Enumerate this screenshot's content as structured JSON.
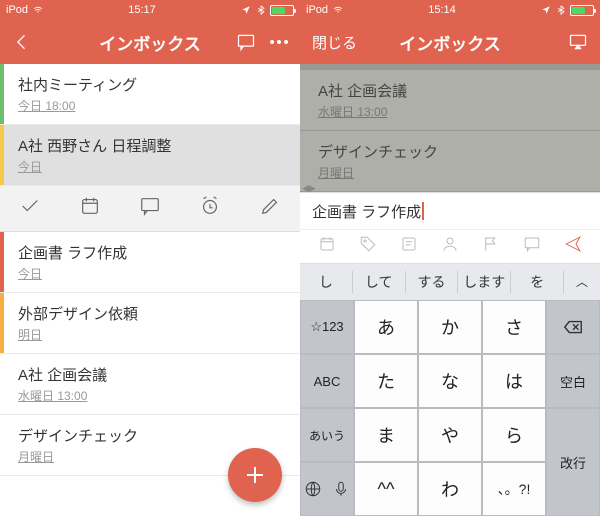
{
  "left": {
    "status": {
      "device": "iPod",
      "time": "15:17"
    },
    "nav": {
      "title": "インボックス"
    },
    "items": [
      {
        "title": "社内ミーティング",
        "sub": "今日 18:00",
        "accent": "green"
      },
      {
        "title": "A社 西野さん 日程調整",
        "sub": "今日",
        "accent": "yellow",
        "selected": true
      },
      {
        "title": "企画書 ラフ作成",
        "sub": "今日",
        "accent": "red"
      },
      {
        "title": "外部デザイン依頼",
        "sub": "明日",
        "accent": "orange"
      },
      {
        "title": "A社 企画会議",
        "sub": "水曜日 13:00",
        "accent": ""
      },
      {
        "title": "デザインチェック",
        "sub": "月曜日",
        "accent": ""
      }
    ]
  },
  "right": {
    "status": {
      "device": "iPod",
      "time": "15:14"
    },
    "nav": {
      "close": "閉じる",
      "title": "インボックス"
    },
    "dim_items": [
      {
        "title": "A社 企画会議",
        "sub": "水曜日 13:00"
      },
      {
        "title": "デザインチェック",
        "sub": "月曜日"
      }
    ],
    "input_text": "企画書 ラフ作成",
    "suggestions": [
      "し",
      "して",
      "する",
      "します",
      "を"
    ],
    "kana": {
      "r1": [
        "あ",
        "か",
        "さ"
      ],
      "r2": [
        "た",
        "な",
        "は"
      ],
      "r3": [
        "ま",
        "や",
        "ら"
      ],
      "r4": [
        "^^",
        "わ",
        "、。?!"
      ]
    },
    "fn": {
      "num": "☆123",
      "abc": "ABC",
      "aiu": "あいう",
      "space": "空白",
      "enter": "改行"
    }
  }
}
